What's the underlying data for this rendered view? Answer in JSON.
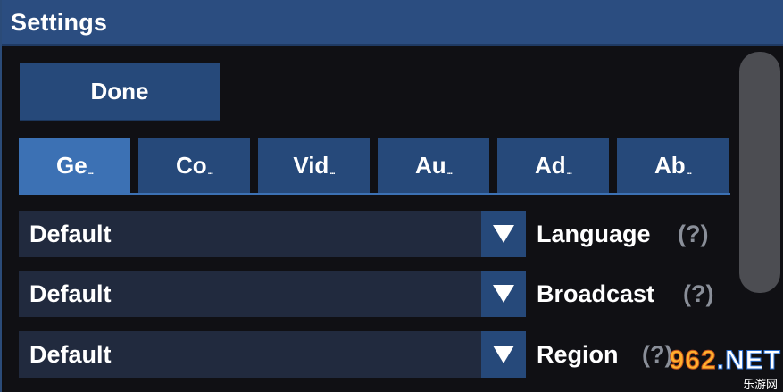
{
  "window": {
    "title": "Settings"
  },
  "done_button": {
    "label": "Done"
  },
  "tabs": [
    {
      "label": "Ge",
      "active": true
    },
    {
      "label": "Co",
      "active": false
    },
    {
      "label": "Vid",
      "active": false
    },
    {
      "label": "Au",
      "active": false
    },
    {
      "label": "Ad",
      "active": false
    },
    {
      "label": "Ab",
      "active": false
    }
  ],
  "tab_ellipsis": "...",
  "settings": [
    {
      "value": "Default",
      "label": "Language",
      "help": "(?)"
    },
    {
      "value": "Default",
      "label": "Broadcast",
      "help": "(?)"
    },
    {
      "value": "Default",
      "label": "Region",
      "help": "(?)"
    }
  ],
  "dropdown_icon": "triangle-down-icon",
  "watermark": {
    "main_prefix": "",
    "main_number": "962",
    "main_suffix": ".NET",
    "sub": "乐游网"
  },
  "colors": {
    "title_bar": "#2b4d80",
    "button": "#26497a",
    "tab_active": "#3c71b4",
    "select_bg": "#212a3e",
    "help_text": "#8a8f99",
    "scroll_thumb": "#4c4d52"
  }
}
